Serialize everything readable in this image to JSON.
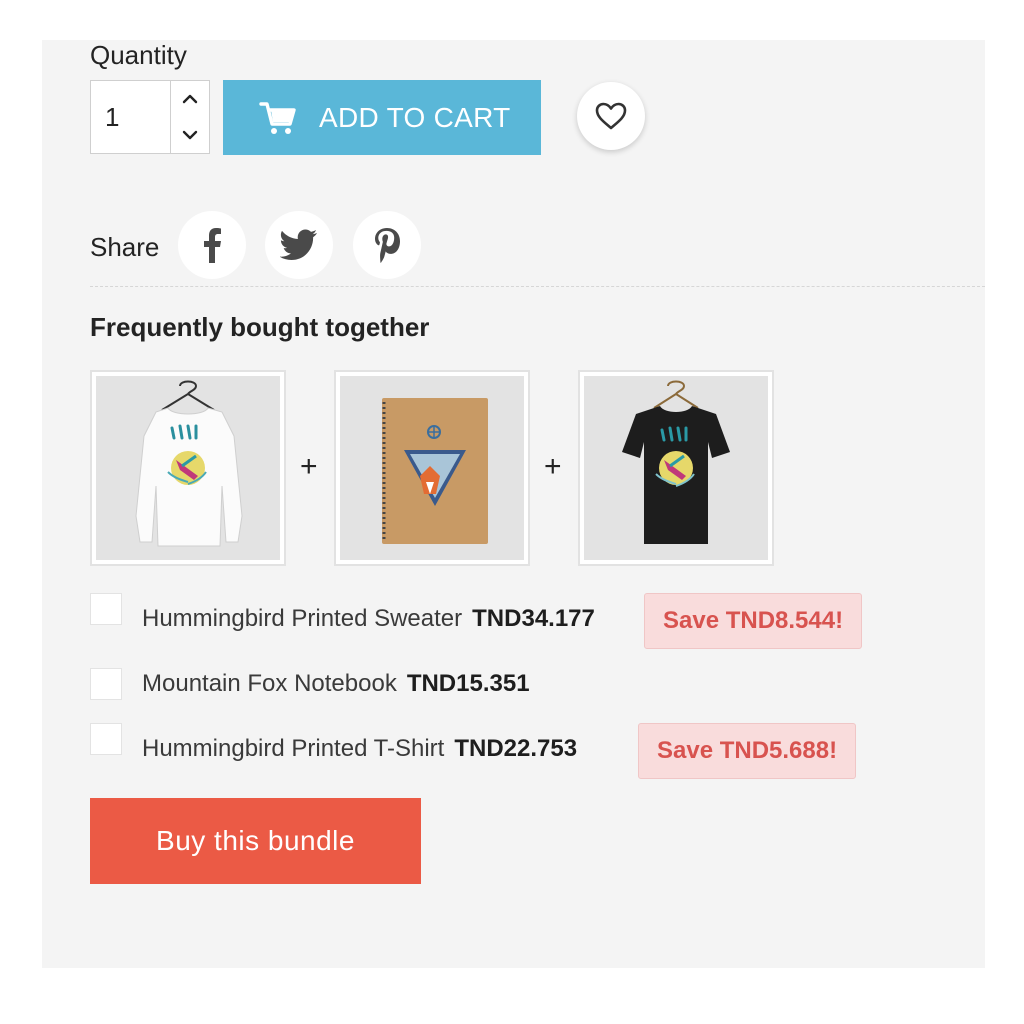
{
  "quantity": {
    "label": "Quantity",
    "value": "1"
  },
  "cart": {
    "add_label": "ADD TO CART"
  },
  "share": {
    "label": "Share"
  },
  "fbt": {
    "title": "Frequently bought together",
    "plus": "+",
    "items": [
      {
        "name": "Hummingbird Printed Sweater",
        "price": "TND34.177",
        "save": "Save TND8.544!"
      },
      {
        "name": "Mountain Fox Notebook",
        "price": "TND15.351",
        "save": ""
      },
      {
        "name": "Hummingbird Printed T-Shirt",
        "price": "TND22.753",
        "save": "Save TND5.688!"
      }
    ],
    "buy_label": "Buy this bundle"
  },
  "icons": {
    "cart": "cart-icon",
    "heart": "heart-icon",
    "facebook": "facebook-icon",
    "twitter": "twitter-icon",
    "pinterest": "pinterest-icon",
    "up": "chevron-up-icon",
    "down": "chevron-down-icon"
  },
  "colors": {
    "add_to_cart": "#5ab7d8",
    "buy_bundle": "#eb5a45",
    "save_badge_bg": "#f9dcdc",
    "save_badge_text": "#d8534f",
    "panel_bg": "#f4f4f4"
  }
}
